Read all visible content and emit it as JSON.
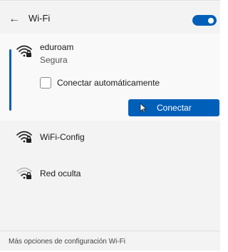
{
  "header": {
    "back_glyph": "←",
    "title": "Wi-Fi",
    "toggle_on": true
  },
  "selected_network": {
    "name": "eduroam",
    "status": "Segura",
    "auto_connect_label": "Conectar automáticamente",
    "auto_connect_checked": false,
    "connect_label": "Conectar",
    "icon": "wifi-secured-icon"
  },
  "networks": [
    {
      "name": "WiFi-Config",
      "icon": "wifi-secured-icon"
    },
    {
      "name": "Red oculta",
      "icon": "wifi-secured-weak-icon"
    }
  ],
  "footer": {
    "link_label": "Más opciones de configuración Wi-Fi"
  },
  "colors": {
    "accent": "#005fb8",
    "panel_bg": "#f3f3f3",
    "selected_bg": "#f9f9f9"
  }
}
